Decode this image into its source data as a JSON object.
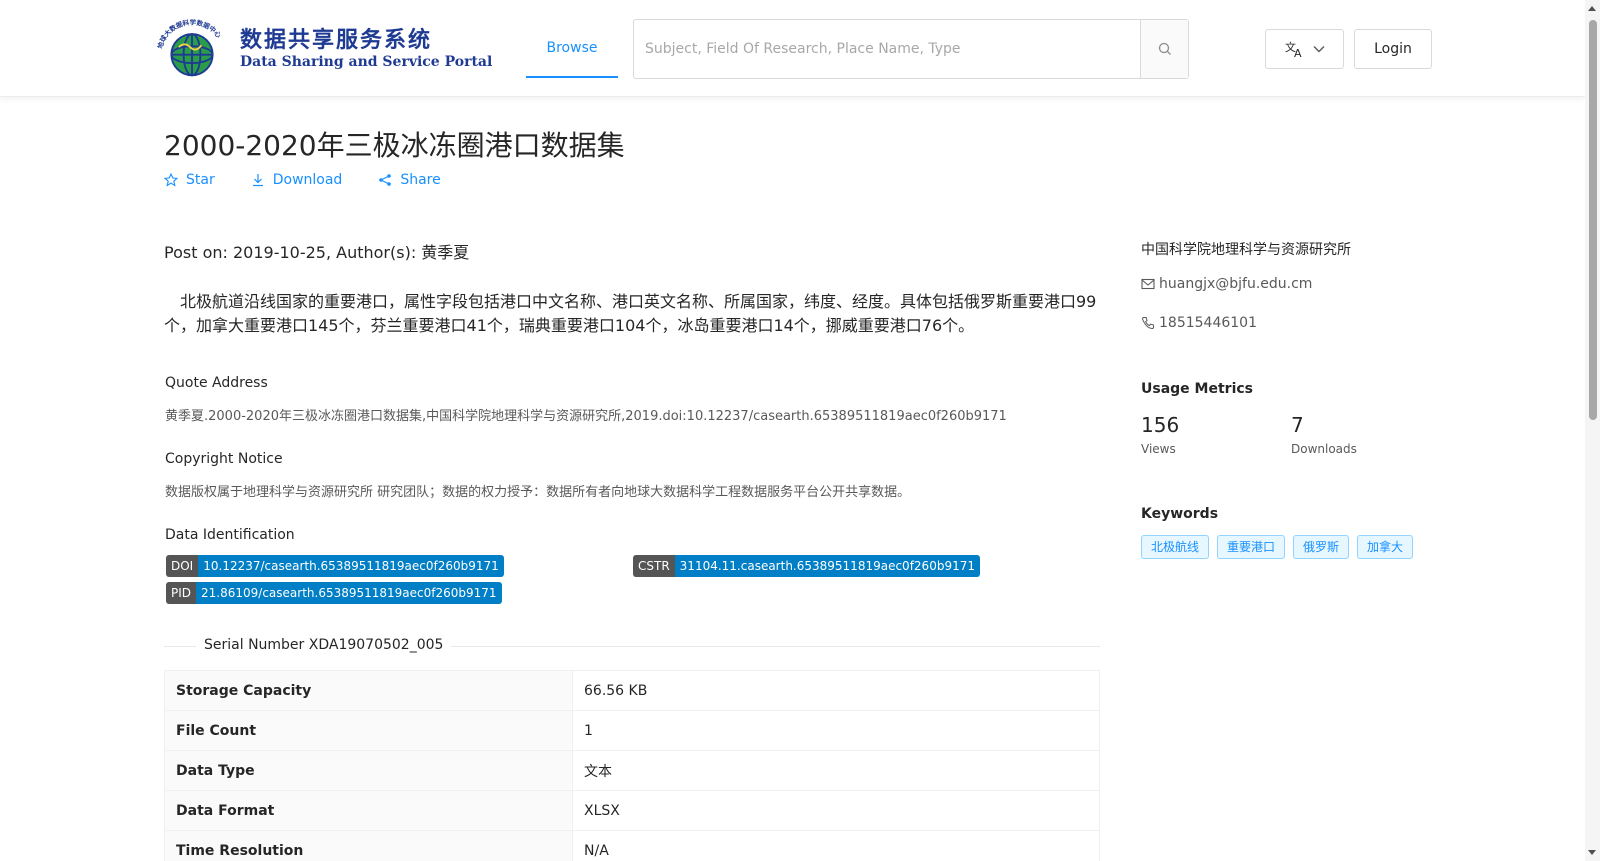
{
  "header": {
    "logo_cn": "数据共享服务系统",
    "logo_en": "Data Sharing and Service Portal",
    "logo_ring_text": "地球大数据科学数据中心",
    "nav_browse": "Browse",
    "search_placeholder": "Subject, Field Of Research, Place Name, Type",
    "login": "Login"
  },
  "dataset": {
    "title": "2000-2020年三极冰冻圈港口数据集",
    "actions": {
      "star": "Star",
      "download": "Download",
      "share": "Share"
    },
    "post_meta": "Post on: 2019-10-25, Author(s): 黄季夏",
    "description": "北极航道沿线国家的重要港口，属性字段包括港口中文名称、港口英文名称、所属国家，纬度、经度。具体包括俄罗斯重要港口99个，加拿大重要港口145个，芬兰重要港口41个，瑞典重要港口104个，冰岛重要港口14个，挪威重要港口76个。",
    "quote_label": "Quote Address",
    "quote_text": "黄季夏.2000-2020年三极冰冻圈港口数据集,中国科学院地理科学与资源研究所,2019.doi:10.12237/casearth.65389511819aec0f260b9171",
    "copyright_label": "Copyright Notice",
    "copyright_text": "数据版权属于地理科学与资源研究所 研究团队；数据的权力授予：数据所有者向地球大数据科学工程数据服务平台公开共享数据。",
    "identification_label": "Data Identification",
    "identifiers": {
      "doi_key": "DOI",
      "doi_value": "10.12237/casearth.65389511819aec0f260b9171",
      "cstr_key": "CSTR",
      "cstr_value": "31104.11.casearth.65389511819aec0f260b9171",
      "pid_key": "PID",
      "pid_value": "21.86109/casearth.65389511819aec0f260b9171"
    },
    "serial_number": "Serial Number XDA19070502_005",
    "properties": [
      {
        "key": "Storage Capacity",
        "value": "66.56 KB"
      },
      {
        "key": "File Count",
        "value": "1"
      },
      {
        "key": "Data Type",
        "value": "文本"
      },
      {
        "key": "Data Format",
        "value": "XLSX"
      },
      {
        "key": "Time Resolution",
        "value": "N/A"
      }
    ]
  },
  "sidebar": {
    "institution": "中国科学院地理科学与资源研究所",
    "email": "huangjx@bjfu.edu.cm",
    "phone": "18515446101",
    "usage_heading": "Usage Metrics",
    "views_count": "156",
    "views_label": "Views",
    "downloads_count": "7",
    "downloads_label": "Downloads",
    "keywords_heading": "Keywords",
    "keywords": [
      "北极航线",
      "重要港口",
      "俄罗斯",
      "加拿大"
    ]
  },
  "colors": {
    "accent": "#1890ff",
    "badge_key": "#555555",
    "badge_value": "#007ec6"
  }
}
